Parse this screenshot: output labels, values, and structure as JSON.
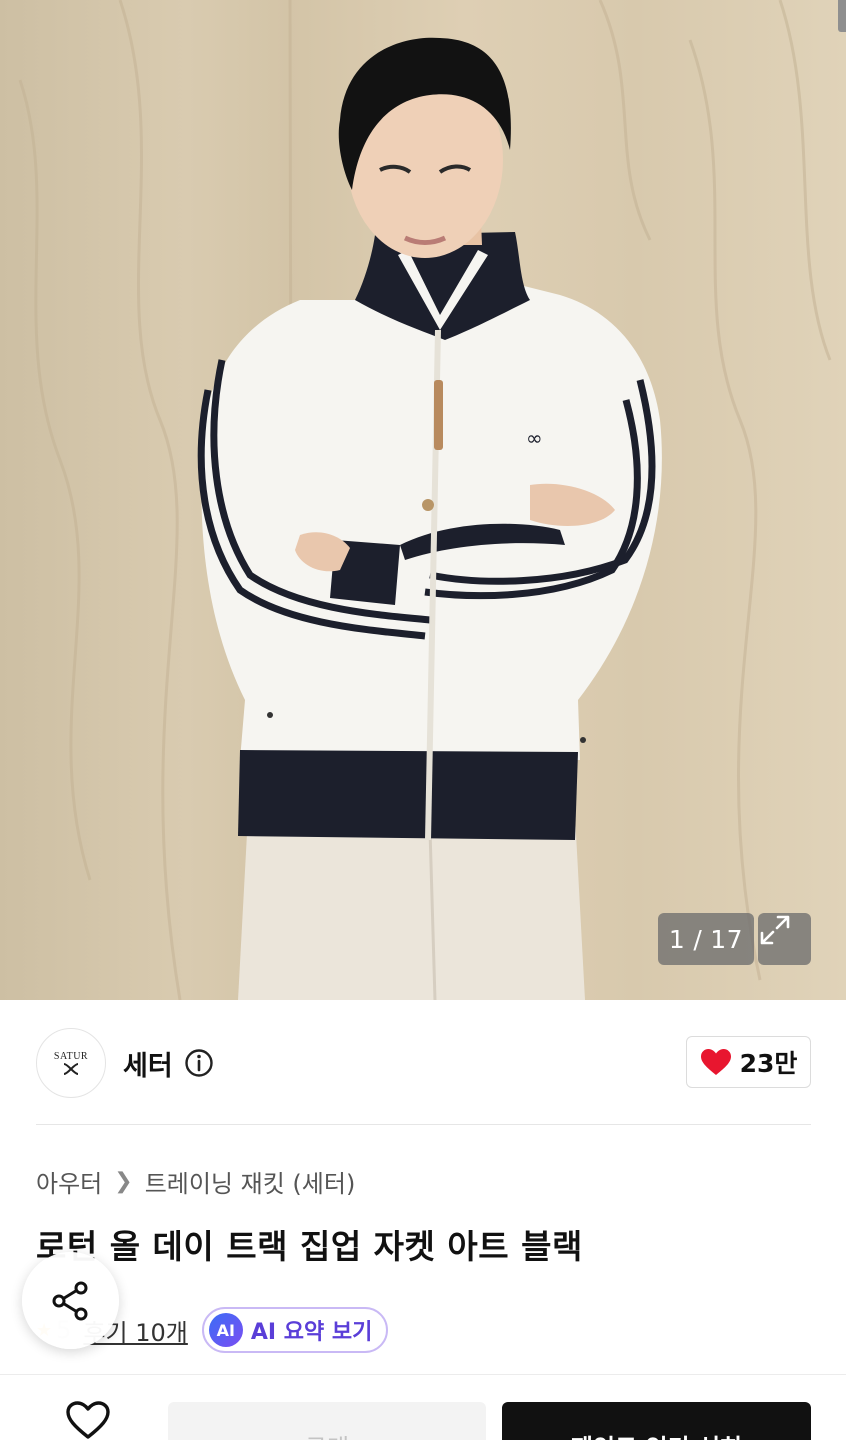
{
  "gallery": {
    "current": "1",
    "separator": "/",
    "total": "17",
    "icon": "expand-icon"
  },
  "brand": {
    "logo_text": "SATUR",
    "name": "세터",
    "info_icon": "info-icon"
  },
  "like": {
    "icon": "heart-icon",
    "color": "#e8162f",
    "count": "23만"
  },
  "breadcrumb": {
    "category": "아우터",
    "separator_icon": "chevron-right-icon",
    "subcategory": "트레이닝 재킷 (세터)"
  },
  "product": {
    "title": "로턴 올 데이 트랙 집업 자켓 아트 블랙"
  },
  "reviews": {
    "star_icon": "star-icon",
    "rating": "5",
    "link_text": "후기 10개",
    "ai_badge": "AI",
    "ai_label": "AI 요약 보기"
  },
  "share": {
    "icon": "share-icon"
  },
  "bottom_bar": {
    "wish_icon": "heart-outline-icon",
    "middle_label": "구매",
    "main_label": "제인드 인키 선히"
  }
}
